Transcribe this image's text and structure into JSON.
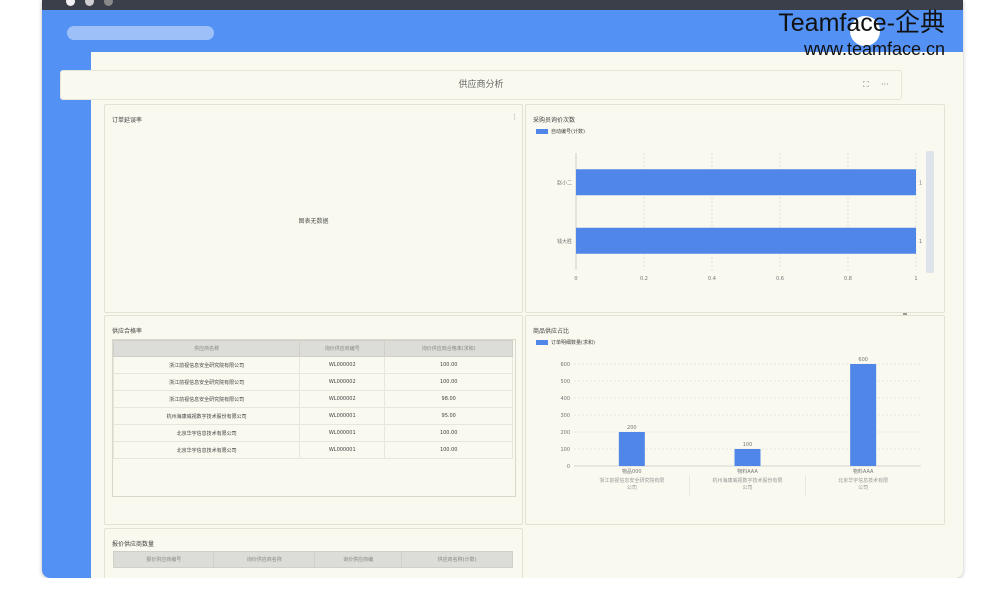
{
  "watermark": {
    "line1": "Teamface-企典",
    "line2": "www.teamface.cn"
  },
  "page": {
    "title": "供应商分析",
    "expand_icon": "expand-icon",
    "more_icon": "more-icon",
    "expand_glyph": "⛶",
    "more_glyph": "···"
  },
  "cards": {
    "order_rate": {
      "title": "订单延误率",
      "kebab": "⋮",
      "empty_text": "图表无数据"
    },
    "purchaser_count": {
      "title": "采购员询价次数"
    },
    "supplier_pass": {
      "title": "供应合格率",
      "columns": [
        "供应商名称",
        "询价供应商编号",
        "询价供应商合格率(求和)"
      ],
      "rows": [
        [
          "浙江前视信息安全研究院有限公司",
          "WL000002",
          "100.00"
        ],
        [
          "浙江前视信息安全研究院有限公司",
          "WL000002",
          "100.00"
        ],
        [
          "浙江前视信息安全研究院有限公司",
          "WL000002",
          "98.00"
        ],
        [
          "杭州海康威视数字技术股份有限公司",
          "WL000001",
          "95.00"
        ],
        [
          "北京华宇信息技术有限公司",
          "WL000001",
          "100.00"
        ],
        [
          "北京华宇信息技术有限公司",
          "WL000001",
          "100.00"
        ]
      ]
    },
    "share": {
      "title": "商品供应占比"
    },
    "quote_count": {
      "title": "报价供应商数量",
      "columns": [
        "报价供应商编号",
        "询价供应商名称",
        "询价供应商编",
        "供应商名称(计数)"
      ]
    }
  },
  "chart_data": [
    {
      "type": "bar",
      "orientation": "horizontal",
      "title": "采购员询价次数",
      "categories": [
        "赵小二",
        "钱大胜"
      ],
      "series": [
        {
          "name": "自动编号(计数)",
          "values": [
            1,
            1
          ]
        }
      ],
      "xlim": [
        0,
        1
      ],
      "xticks": [
        "0",
        "0.2",
        "0.4",
        "0.6",
        "0.8",
        "1"
      ],
      "data_labels": [
        "1",
        "1"
      ],
      "grid": true,
      "legend": "top-left",
      "color": "#4f86e8"
    },
    {
      "type": "bar",
      "title": "商品供应占比",
      "categories": [
        "物品000",
        "物料AAA",
        "物料AAA"
      ],
      "groups": [
        "浙江前视信息安全研究院有限公司",
        "杭州海康威视数字技术股份有限公司",
        "北京华宇信息技术有限公司"
      ],
      "series": [
        {
          "name": "订单明细数量(求和)",
          "values": [
            200,
            100,
            600
          ]
        }
      ],
      "ylim": [
        0,
        600
      ],
      "yticks": [
        "0",
        "100",
        "200",
        "300",
        "400",
        "500",
        "600"
      ],
      "grid": true,
      "legend": "top-left",
      "color": "#4f86e8"
    }
  ]
}
